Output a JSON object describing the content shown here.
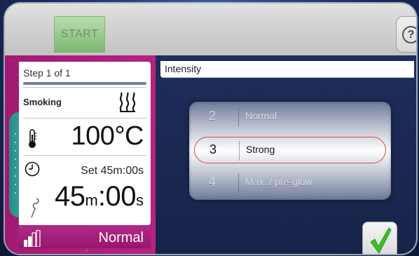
{
  "topbar": {
    "start_label": "START",
    "help_icon": "question-mark-icon",
    "help_label": "?"
  },
  "step_panel": {
    "step_label": "Step  1  of  1",
    "mode_label": "Smoking",
    "mode_icon": "smoke-icon",
    "temperature": "100°C",
    "temperature_icon": "thermometer-icon",
    "timer_icon": "clock-icon",
    "set_time": "Set 45m:00s",
    "time_minutes": "45",
    "time_m_unit": "m",
    "time_colon": ":",
    "time_seconds": "00",
    "time_s_unit": "s",
    "probe_icon": "probe-icon",
    "intensity_icon": "signal-bars-icon",
    "intensity_value": "Normal",
    "scroll_arrow": "▾",
    "accent_color": "#b6237f",
    "side_tab_color": "#36b0a8"
  },
  "intensity": {
    "header": "Intensity",
    "options": [
      {
        "number": "2",
        "label": "Normal"
      },
      {
        "number": "3",
        "label": "Strong"
      },
      {
        "number": "4",
        "label": "Max. / pre-glow"
      }
    ],
    "selected_index": 1,
    "selection_color": "#e0483c"
  },
  "confirm": {
    "icon": "checkmark-icon",
    "color": "#3cbf2a"
  }
}
